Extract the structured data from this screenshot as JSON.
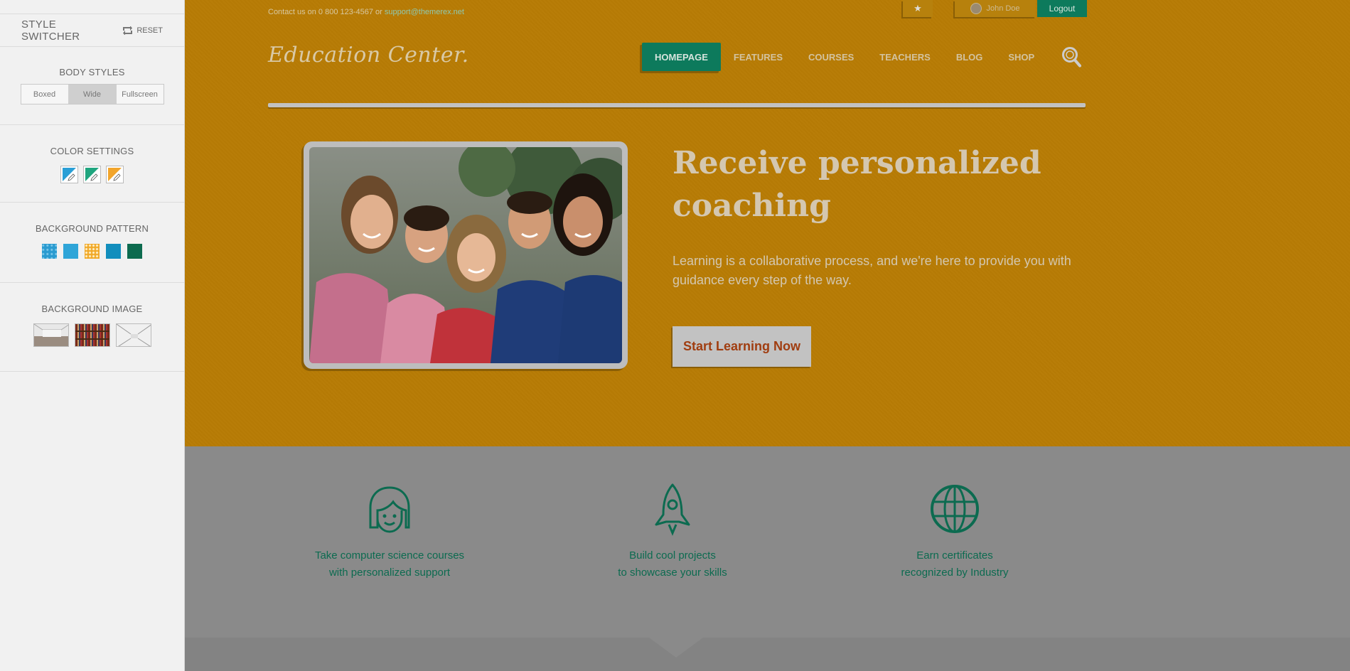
{
  "switcher": {
    "title": "STYLE SWITCHER",
    "reset_label": "RESET",
    "body_styles": {
      "label": "BODY STYLES",
      "options": [
        "Boxed",
        "Wide",
        "Fullscreen"
      ],
      "selected": "Wide"
    },
    "color_settings": {
      "label": "COLOR SETTINGS",
      "colors": [
        "#2a9fd6",
        "#1fa57e",
        "#f2a52b"
      ]
    },
    "background_pattern": {
      "label": "BACKGROUND PATTERN",
      "colors": [
        "#2a9bd0",
        "#2fa5d8",
        "#f1a92a",
        "#128ebd",
        "#0d6b4f"
      ]
    },
    "background_image": {
      "label": "BACKGROUND IMAGE",
      "items": [
        "hall-image",
        "bookshelf-image",
        "corridor-image"
      ]
    }
  },
  "topbar": {
    "contact_prefix": "Contact us on 0 800 123-4567 or",
    "contact_email": "support@themerex.net",
    "user_name": "John Doe",
    "logout_label": "Logout"
  },
  "header": {
    "logo": "Education Center.",
    "nav": [
      "HOMEPAGE",
      "FEATURES",
      "COURSES",
      "TEACHERS",
      "BLOG",
      "SHOP"
    ],
    "active_nav": "HOMEPAGE"
  },
  "hero": {
    "headline": "Receive personalized coaching",
    "lead": "Learning is a collaborative process, and we're here to provide you with guidance every step of the way.",
    "cta_label": "Start Learning Now"
  },
  "features": [
    {
      "icon": "student-face-icon",
      "line1": "Take computer science courses",
      "line2": "with personalized support"
    },
    {
      "icon": "rocket-icon",
      "line1": "Build cool projects",
      "line2": "to showcase your skills"
    },
    {
      "icon": "globe-icon",
      "line1": "Earn certificates",
      "line2": "recognized by Industry"
    }
  ],
  "colors": {
    "accent": "#0d7a5c",
    "hero_bg": "#b87d08",
    "cta_text": "#a03d10"
  }
}
